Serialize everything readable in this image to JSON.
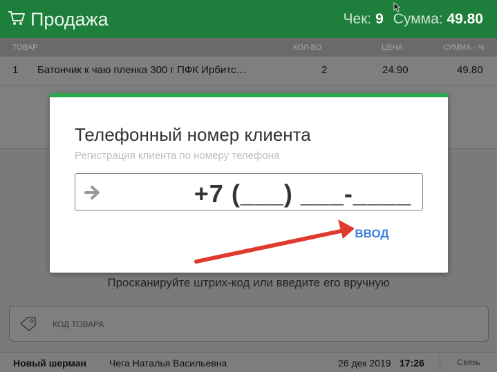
{
  "header": {
    "title": "Продажа",
    "check_label": "Чек:",
    "check_number": "9",
    "sum_label": "Сумма:",
    "sum_value": "49.80"
  },
  "table": {
    "columns": [
      "ТОВАР",
      "КОЛ-ВО",
      "ЦЕНА",
      "СУММА - %"
    ],
    "rows": [
      {
        "num": "1",
        "name": "Батончик к чаю пленка 300 г ПФК Ирбитс…",
        "qty": "2",
        "price": "24.90",
        "sum": "49.80"
      }
    ]
  },
  "hint": "Просканируйте штрих-код или введите его вручную",
  "code_input": {
    "placeholder": "КОД ТОВАРА"
  },
  "status": {
    "shop": "Новый шерман",
    "cashier": "Чега Наталья Васильевна",
    "date": "26 дек 2019",
    "time": "17:26",
    "link_button": "Связь"
  },
  "dialog": {
    "title": "Телефонный номер клиента",
    "subtitle": "Регистрация клиента по номеру телефона",
    "phone_value": "+7 (___) ___-____",
    "enter_button": "ВВОД"
  },
  "colors": {
    "header_bg": "#1d7f3b",
    "accent_green": "#2aa84f",
    "button_blue": "#3d7fe0",
    "annotation_red": "#e03a2e"
  },
  "icons": [
    "cart-icon",
    "cursor-icon",
    "tag-icon",
    "arrow-right-icon"
  ]
}
